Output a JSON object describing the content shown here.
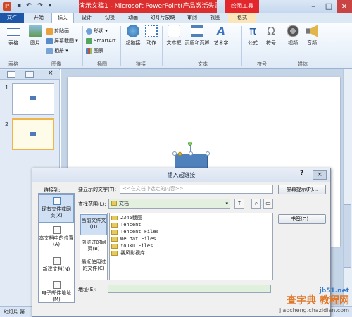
{
  "titlebar": {
    "app_icon": "P",
    "title": "演示文稿1 - Microsoft PowerPoint(产品激活失败)",
    "context_tool": "绘图工具"
  },
  "tabs": [
    "文件",
    "开始",
    "插入",
    "设计",
    "切换",
    "动画",
    "幻灯片放映",
    "审阅",
    "视图",
    "格式"
  ],
  "ribbon": {
    "table": "表格",
    "picture": "图片",
    "clipart": "剪贴画",
    "screenshot": "屏幕截图",
    "album": "相册",
    "shapes": "形状",
    "smartart": "SmartArt",
    "chart": "图表",
    "hyperlink": "超链接",
    "action": "动作",
    "textbox": "文本框",
    "header_footer": "页眉和页脚",
    "wordart": "艺术字",
    "equation": "公式",
    "symbol": "符号",
    "video": "视频",
    "audio": "音频",
    "groups": {
      "tables": "表格",
      "images": "图像",
      "illustrations": "插图",
      "links": "链接",
      "text": "文本",
      "symbols": "符号",
      "media": "媒体"
    }
  },
  "thumbnails": [
    {
      "num": "1"
    },
    {
      "num": "2"
    }
  ],
  "statusbar": {
    "text": "幻灯片 第"
  },
  "dialog": {
    "title": "插入超链接",
    "help": "?",
    "close": "×",
    "link_to_label": "链接到:",
    "link_to": [
      {
        "label": "现有文件或网页(X)"
      },
      {
        "label": "本文档中的位置(A)"
      },
      {
        "label": "新建文档(N)"
      },
      {
        "label": "电子邮件地址(M)"
      }
    ],
    "display_label": "要显示的文字(T):",
    "display_placeholder": "<<在文档中选定的内容>>",
    "screen_tip": "屏幕提示(P)...",
    "lookin_label": "查找范围(L):",
    "lookin_value": "文档",
    "bookmark": "书签(O)...",
    "side": [
      {
        "label": "当前文件夹(U)"
      },
      {
        "label": "浏览过的网页(B)"
      },
      {
        "label": "最近使用过的文件(C)"
      }
    ],
    "files": [
      "2345截图",
      "Tencent",
      "Tencent Files",
      "WeChat Files",
      "Youku Files",
      "暴风影视库"
    ],
    "address_label": "地址(E):"
  },
  "watermark": {
    "text": "查字典 教程网",
    "url": "jiaocheng.chazidian.com",
    "site": "jb51.net"
  },
  "colors": {
    "file_tab": "#1e56a8",
    "title_red": "#dc2e2e",
    "shape_blue": "#4f81bd",
    "selection": "#f0b448"
  }
}
